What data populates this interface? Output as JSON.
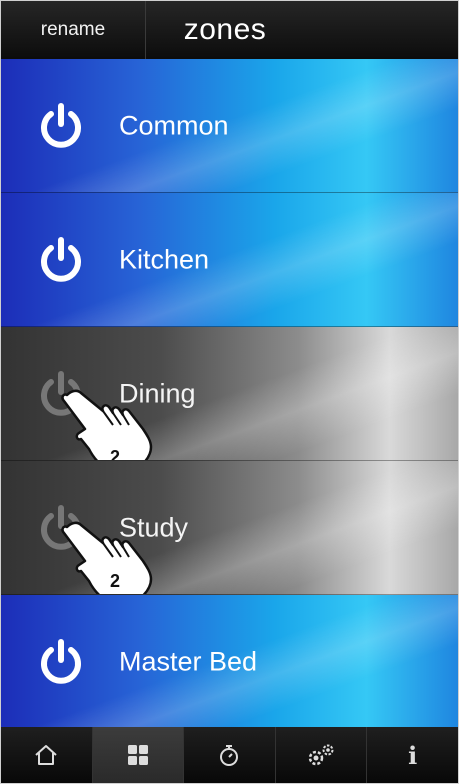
{
  "header": {
    "rename_label": "rename",
    "title": "zones"
  },
  "zones": [
    {
      "name": "Common",
      "state": "on"
    },
    {
      "name": "Kitchen",
      "state": "on"
    },
    {
      "name": "Dining",
      "state": "off",
      "tap_badge": "2"
    },
    {
      "name": "Study",
      "state": "off",
      "tap_badge": "2"
    },
    {
      "name": "Master Bed",
      "state": "on"
    }
  ],
  "footer": {
    "items": [
      {
        "icon": "home-icon"
      },
      {
        "icon": "grid-icon",
        "active": true
      },
      {
        "icon": "timer-icon"
      },
      {
        "icon": "gears-icon"
      },
      {
        "icon": "info-icon",
        "label": "i"
      }
    ]
  },
  "colors": {
    "on_zone_blue": "#1aa6ea",
    "off_zone_gray": "#6a6a6a",
    "header_bg": "#111111"
  }
}
